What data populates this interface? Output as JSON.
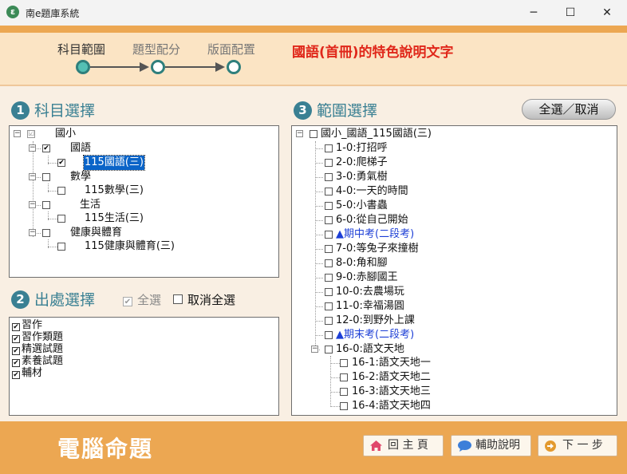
{
  "window": {
    "title": "南e題庫系統",
    "icon": "app-logo-icon",
    "controls": {
      "minimize": "─",
      "maximize": "☐",
      "close": "✕"
    }
  },
  "wizard": {
    "steps": [
      "科目範圍",
      "題型配分",
      "版面配置"
    ],
    "current_step": 1,
    "subject_note": "國語(首冊)的特色說明文字"
  },
  "section1": {
    "number": "1",
    "title": "科目選擇",
    "tree": [
      {
        "label": "國小",
        "check": "☑"
      },
      {
        "label": "國語",
        "check": "✔"
      },
      {
        "label": "115國語(三)",
        "check": "✔",
        "selected": true
      },
      {
        "label": "數學",
        "check": ""
      },
      {
        "label": "115數學(三)",
        "check": ""
      },
      {
        "label": "生活",
        "check": ""
      },
      {
        "label": "115生活(三)",
        "check": ""
      },
      {
        "label": "健康與體育",
        "check": ""
      },
      {
        "label": "115健康與體育(三)",
        "check": ""
      }
    ]
  },
  "section2": {
    "number": "2",
    "title": "出處選擇",
    "select_all_label": "全選",
    "deselect_all_label": "取消全選",
    "items": [
      {
        "label": "習作",
        "check": "✔"
      },
      {
        "label": "習作類題",
        "check": "✔"
      },
      {
        "label": "精選試題",
        "check": "✔"
      },
      {
        "label": "素養試題",
        "check": "✔"
      },
      {
        "label": "輔材",
        "check": "✔"
      }
    ]
  },
  "section3": {
    "number": "3",
    "title": "範圍選擇",
    "toggle_all_label": "全選／取消",
    "root": "國小_國語_115國語(三)",
    "items": [
      {
        "label": "1-0:打招呼"
      },
      {
        "label": "2-0:爬梯子"
      },
      {
        "label": "3-0:勇氣樹"
      },
      {
        "label": "4-0:一天的時間"
      },
      {
        "label": "5-0:小書蟲"
      },
      {
        "label": "6-0:從自己開始"
      },
      {
        "label": "▲期中考(二段考)",
        "highlight": true
      },
      {
        "label": "7-0:等兔子來撞樹"
      },
      {
        "label": "8-0:角和腳"
      },
      {
        "label": "9-0:赤腳國王"
      },
      {
        "label": "10-0:去農場玩"
      },
      {
        "label": "11-0:幸福湯圓"
      },
      {
        "label": "12-0:到野外上課"
      },
      {
        "label": "▲期末考(二段考)",
        "highlight": true
      },
      {
        "label": "16-0:語文天地"
      }
    ],
    "subitems": [
      {
        "label": "16-1:語文天地一"
      },
      {
        "label": "16-2:語文天地二"
      },
      {
        "label": "16-3:語文天地三"
      },
      {
        "label": "16-4:語文天地四"
      }
    ]
  },
  "footer": {
    "brand": "電腦命題",
    "home": "回 主 頁",
    "help": "輔助說明",
    "next": "下 一 步"
  },
  "colors": {
    "accent_orange": "#eca752",
    "section_teal": "#3a8093",
    "note_red": "#e0271a",
    "selection_blue": "#0a64c8"
  }
}
